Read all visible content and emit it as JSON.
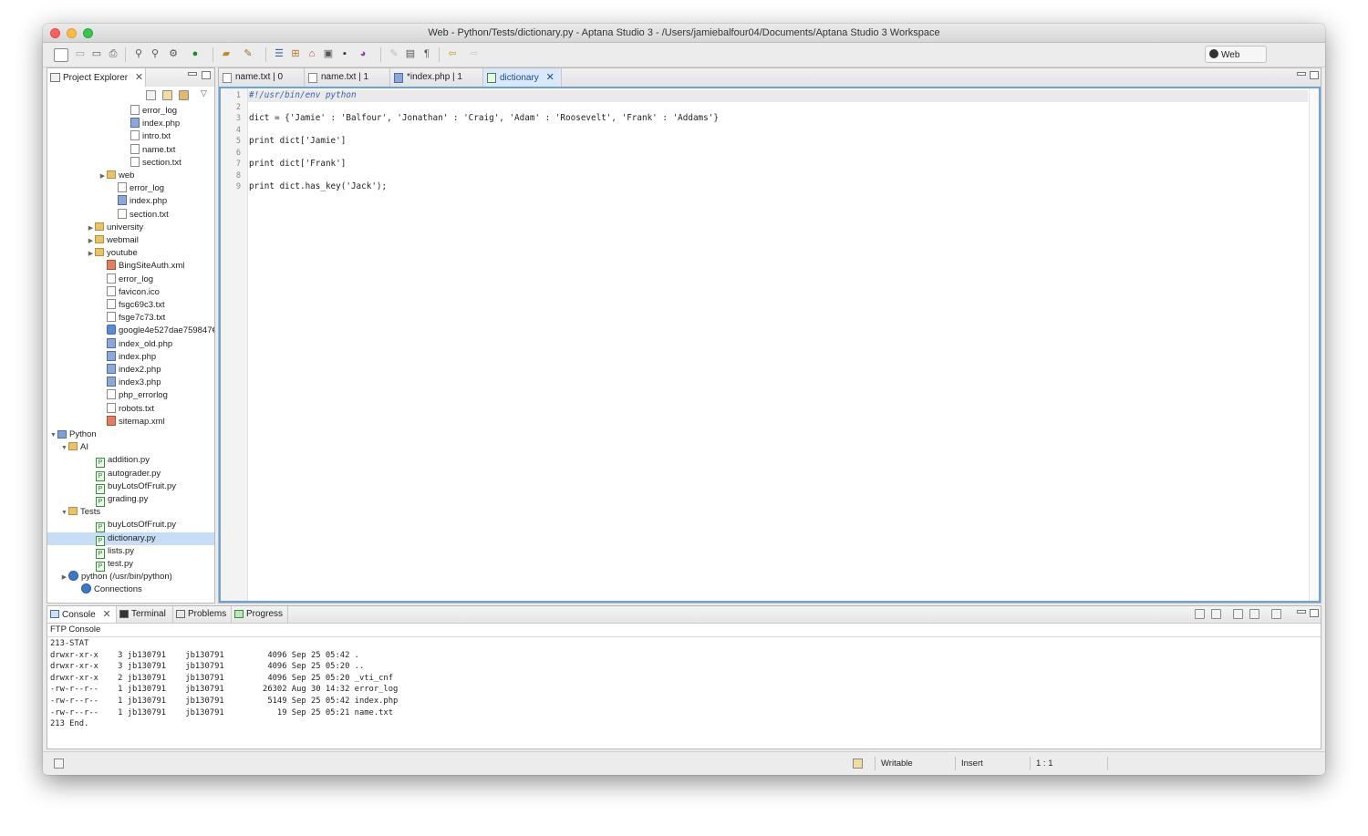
{
  "window": {
    "title": "Web - Python/Tests/dictionary.py - Aptana Studio 3 - /Users/jamiebalfour04/Documents/Aptana Studio 3 Workspace"
  },
  "perspective": {
    "label": "Web"
  },
  "explorer": {
    "tab_label": "Project Explorer",
    "nodes": [
      {
        "label": "error_log",
        "icon": "file-icon"
      },
      {
        "label": "index.php",
        "icon": "php-file-icon"
      },
      {
        "label": "intro.txt",
        "icon": "file-icon"
      },
      {
        "label": "name.txt",
        "icon": "file-icon"
      },
      {
        "label": "section.txt",
        "icon": "file-icon"
      },
      {
        "label": "web",
        "icon": "folder-icon",
        "expander": "collapsed"
      },
      {
        "label": "error_log",
        "icon": "file-icon"
      },
      {
        "label": "index.php",
        "icon": "php-file-icon"
      },
      {
        "label": "section.txt",
        "icon": "file-icon"
      },
      {
        "label": "university",
        "icon": "folder-icon",
        "expander": "collapsed"
      },
      {
        "label": "webmail",
        "icon": "folder-icon",
        "expander": "collapsed"
      },
      {
        "label": "youtube",
        "icon": "folder-icon",
        "expander": "collapsed"
      },
      {
        "label": "BingSiteAuth.xml",
        "icon": "xml-file-icon"
      },
      {
        "label": "error_log",
        "icon": "file-icon"
      },
      {
        "label": "favicon.ico",
        "icon": "file-icon"
      },
      {
        "label": "fsgc69c3.txt",
        "icon": "file-icon"
      },
      {
        "label": "fsge7c73.txt",
        "icon": "file-icon"
      },
      {
        "label": "google4e527dae759847€",
        "icon": "html-file-icon"
      },
      {
        "label": "index_old.php",
        "icon": "php-file-icon"
      },
      {
        "label": "index.php",
        "icon": "php-file-icon"
      },
      {
        "label": "index2.php",
        "icon": "php-file-icon"
      },
      {
        "label": "index3.php",
        "icon": "php-file-icon"
      },
      {
        "label": "php_errorlog",
        "icon": "file-icon"
      },
      {
        "label": "robots.txt",
        "icon": "file-icon"
      },
      {
        "label": "sitemap.xml",
        "icon": "xml-file-icon"
      },
      {
        "label": "Python",
        "icon": "project-icon",
        "expander": "expanded"
      },
      {
        "label": "AI",
        "icon": "folder-icon",
        "expander": "expanded"
      },
      {
        "label": "addition.py",
        "icon": "python-file-icon"
      },
      {
        "label": "autograder.py",
        "icon": "python-file-icon"
      },
      {
        "label": "buyLotsOfFruit.py",
        "icon": "python-file-icon"
      },
      {
        "label": "grading.py",
        "icon": "python-file-icon"
      },
      {
        "label": "Tests",
        "icon": "folder-icon",
        "expander": "expanded"
      },
      {
        "label": "buyLotsOfFruit.py",
        "icon": "python-file-icon"
      },
      {
        "label": "dictionary.py",
        "icon": "python-file-icon",
        "selected": true
      },
      {
        "label": "lists.py",
        "icon": "python-file-icon"
      },
      {
        "label": "test.py",
        "icon": "python-file-icon"
      },
      {
        "label": "python  (/usr/bin/python)",
        "icon": "python-interpreter-icon",
        "expander": "collapsed"
      },
      {
        "label": "Connections",
        "icon": "globe-icon"
      }
    ]
  },
  "editor": {
    "tabs": [
      {
        "label": "name.txt | 0"
      },
      {
        "label": "name.txt | 1"
      },
      {
        "label": "*index.php | 1"
      },
      {
        "label": "dictionary",
        "active": true
      }
    ],
    "lines": [
      {
        "num": "1",
        "text": "#!/usr/bin/env python",
        "kind": "comment"
      },
      {
        "num": "2",
        "text": ""
      },
      {
        "num": "3",
        "text": "dict = {'Jamie' : 'Balfour', 'Jonathan' : 'Craig', 'Adam' : 'Roosevelt', 'Frank' : 'Addams'}"
      },
      {
        "num": "4",
        "text": ""
      },
      {
        "num": "5",
        "text": "print dict['Jamie']"
      },
      {
        "num": "6",
        "text": ""
      },
      {
        "num": "7",
        "text": "print dict['Frank']"
      },
      {
        "num": "8",
        "text": ""
      },
      {
        "num": "9",
        "text": "print dict.has_key('Jack');"
      }
    ]
  },
  "console": {
    "tabs": [
      "Console",
      "Terminal",
      "Problems",
      "Progress"
    ],
    "title": "FTP Console",
    "lines": [
      "213-STAT",
      "drwxr-xr-x    3 jb130791    jb130791         4096 Sep 25 05:42 .",
      "drwxr-xr-x    3 jb130791    jb130791         4096 Sep 25 05:20 ..",
      "drwxr-xr-x    2 jb130791    jb130791         4096 Sep 25 05:20 _vti_cnf",
      "-rw-r--r--    1 jb130791    jb130791        26302 Aug 30 14:32 error_log",
      "-rw-r--r--    1 jb130791    jb130791         5149 Sep 25 05:42 index.php",
      "-rw-r--r--    1 jb130791    jb130791           19 Sep 25 05:21 name.txt",
      "213 End."
    ]
  },
  "status": {
    "writable": "Writable",
    "insert_mode": "Insert",
    "cursor_position": "1 : 1"
  },
  "colors": {
    "accent": "#6ba2dc",
    "selection": "#c7dcf5",
    "comment": "#3b63b4"
  }
}
